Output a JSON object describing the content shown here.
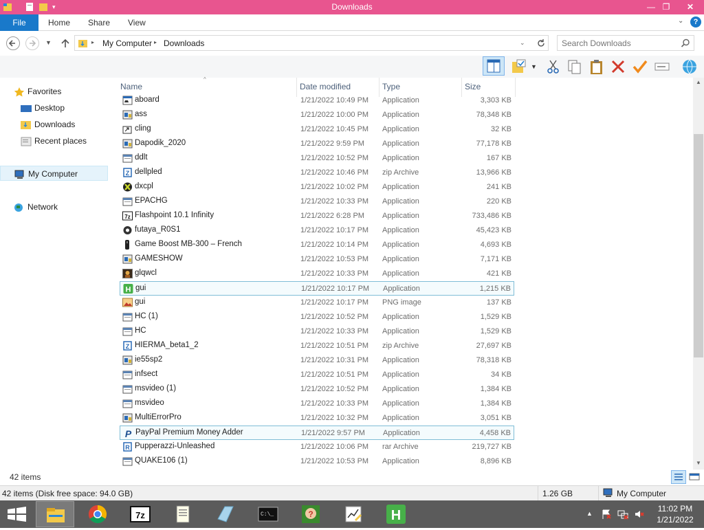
{
  "window": {
    "title": "Downloads",
    "controls": {
      "minimize": "—",
      "restore": "❐",
      "close": "✕"
    }
  },
  "ribbon": {
    "file": "File",
    "tabs": [
      "Home",
      "Share",
      "View"
    ]
  },
  "address": {
    "path": [
      "My Computer",
      "Downloads"
    ],
    "search_placeholder": "Search Downloads"
  },
  "nav": {
    "favorites": "Favorites",
    "favorites_items": [
      "Desktop",
      "Downloads",
      "Recent places"
    ],
    "computer": "My Computer",
    "network": "Network"
  },
  "columns": {
    "name": "Name",
    "date": "Date modified",
    "type": "Type",
    "size": "Size"
  },
  "files": [
    {
      "name": "aboard",
      "date": "1/21/2022 10:49 PM",
      "type": "Application",
      "size": "3,303 KB",
      "icon": "app-icon"
    },
    {
      "name": "ass",
      "date": "1/21/2022 10:00 PM",
      "type": "Application",
      "size": "78,348 KB",
      "icon": "installer-icon"
    },
    {
      "name": "cling",
      "date": "1/21/2022 10:45 PM",
      "type": "Application",
      "size": "32 KB",
      "icon": "shortcut-icon"
    },
    {
      "name": "Dapodik_2020",
      "date": "1/21/2022 9:59 PM",
      "type": "Application",
      "size": "77,178 KB",
      "icon": "installer-icon"
    },
    {
      "name": "ddlt",
      "date": "1/21/2022 10:52 PM",
      "type": "Application",
      "size": "167 KB",
      "icon": "window-icon"
    },
    {
      "name": "dellpled",
      "date": "1/21/2022 10:46 PM",
      "type": "zip Archive",
      "size": "13,966 KB",
      "icon": "zip-icon"
    },
    {
      "name": "dxcpl",
      "date": "1/21/2022 10:02 PM",
      "type": "Application",
      "size": "241 KB",
      "icon": "directx-icon"
    },
    {
      "name": "EPACHG",
      "date": "1/21/2022 10:33 PM",
      "type": "Application",
      "size": "220 KB",
      "icon": "window-icon"
    },
    {
      "name": "Flashpoint 10.1 Infinity",
      "date": "1/21/2022 6:28 PM",
      "type": "Application",
      "size": "733,486 KB",
      "icon": "7z-icon"
    },
    {
      "name": "futaya_R0S1",
      "date": "1/21/2022 10:17 PM",
      "type": "Application",
      "size": "45,423 KB",
      "icon": "gear-icon"
    },
    {
      "name": "Game Boost MB-300 – French",
      "date": "1/21/2022 10:14 PM",
      "type": "Application",
      "size": "4,693 KB",
      "icon": "device-icon"
    },
    {
      "name": "GAMESHOW",
      "date": "1/21/2022 10:53 PM",
      "type": "Application",
      "size": "7,171 KB",
      "icon": "installer-icon"
    },
    {
      "name": "glqwcl",
      "date": "1/21/2022 10:33 PM",
      "type": "Application",
      "size": "421 KB",
      "icon": "game-icon"
    },
    {
      "name": "gui",
      "date": "1/21/2022 10:17 PM",
      "type": "Application",
      "size": "1,215 KB",
      "icon": "h-icon"
    },
    {
      "name": "gui",
      "date": "1/21/2022 10:17 PM",
      "type": "PNG image",
      "size": "137 KB",
      "icon": "image-icon"
    },
    {
      "name": "HC (1)",
      "date": "1/21/2022 10:52 PM",
      "type": "Application",
      "size": "1,529 KB",
      "icon": "window-icon"
    },
    {
      "name": "HC",
      "date": "1/21/2022 10:33 PM",
      "type": "Application",
      "size": "1,529 KB",
      "icon": "window-icon"
    },
    {
      "name": "HIERMA_beta1_2",
      "date": "1/21/2022 10:51 PM",
      "type": "zip Archive",
      "size": "27,697 KB",
      "icon": "zip-icon"
    },
    {
      "name": "ie55sp2",
      "date": "1/21/2022 10:31 PM",
      "type": "Application",
      "size": "78,318 KB",
      "icon": "installer-icon"
    },
    {
      "name": "infsect",
      "date": "1/21/2022 10:51 PM",
      "type": "Application",
      "size": "34 KB",
      "icon": "window-icon"
    },
    {
      "name": "msvideo (1)",
      "date": "1/21/2022 10:52 PM",
      "type": "Application",
      "size": "1,384 KB",
      "icon": "window-icon"
    },
    {
      "name": "msvideo",
      "date": "1/21/2022 10:33 PM",
      "type": "Application",
      "size": "1,384 KB",
      "icon": "window-icon"
    },
    {
      "name": "MultiErrorPro",
      "date": "1/21/2022 10:32 PM",
      "type": "Application",
      "size": "3,051 KB",
      "icon": "installer-icon"
    },
    {
      "name": "PayPal Premium Money Adder",
      "date": "1/21/2022 9:57 PM",
      "type": "Application",
      "size": "4,458 KB",
      "icon": "paypal-icon"
    },
    {
      "name": "Pupperazzi-Unleashed",
      "date": "1/21/2022 10:06 PM",
      "type": "rar Archive",
      "size": "219,727 KB",
      "icon": "rar-icon"
    },
    {
      "name": "QUAKE106 (1)",
      "date": "1/21/2022 10:53 PM",
      "type": "Application",
      "size": "8,896 KB",
      "icon": "window-icon"
    }
  ],
  "status": {
    "item_count": "42 items",
    "detail": "42 items (Disk free space: 94.0 GB)",
    "size": "1.26 GB",
    "location": "My Computer"
  },
  "taskbar": {
    "time": "11:02 PM",
    "date": "1/21/2022",
    "apps": [
      "file-explorer-icon",
      "chrome-icon",
      "7zip-icon",
      "notepad-icon",
      "glass-icon",
      "cmd-icon",
      "puzzle-icon",
      "chart-editor-icon",
      "h-app-icon"
    ]
  },
  "colors": {
    "titlebar": "#e8558f",
    "file_tab": "#1979ca",
    "taskbar": "#5b5b5b"
  }
}
